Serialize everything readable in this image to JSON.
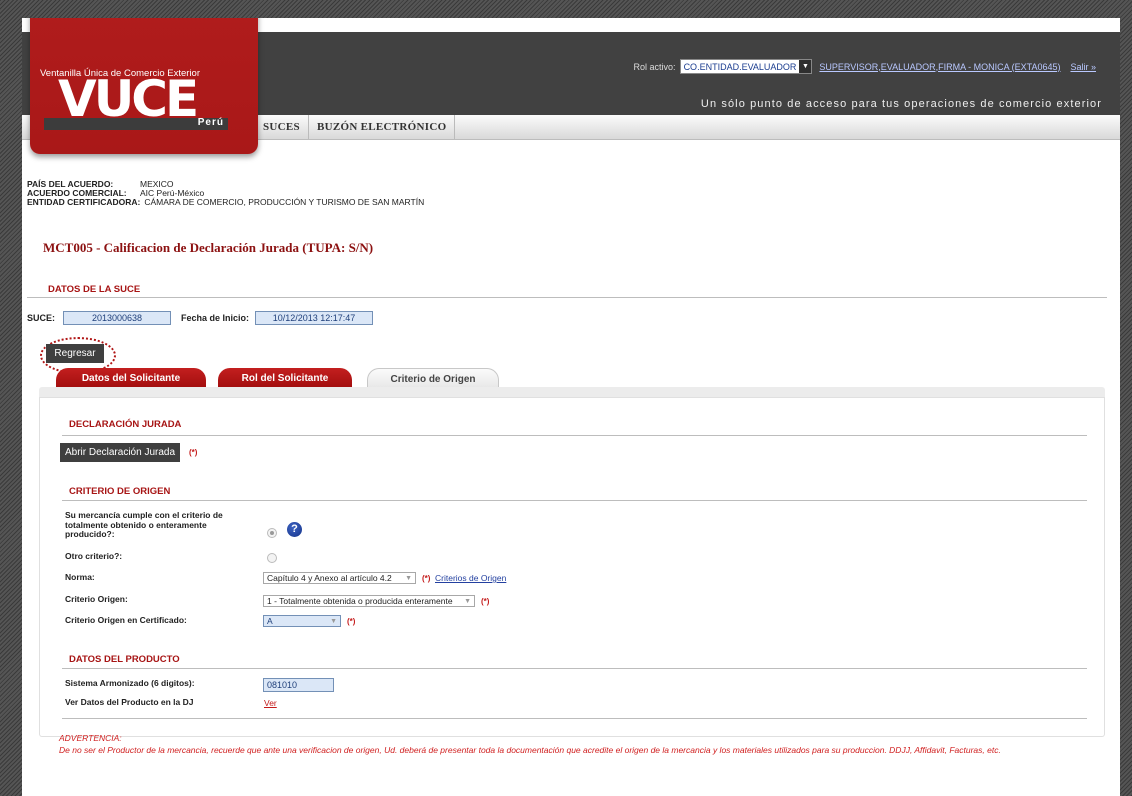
{
  "header": {
    "logo": {
      "subtitle": "Ventanilla Única de Comercio Exterior",
      "name": "VUCE",
      "country": "Perú"
    },
    "rol_label": "Rol activo:",
    "rol_value": "CO.ENTIDAD.EVALUADOR",
    "user_link": "SUPERVISOR,EVALUADOR,FIRMA - MONICA (EXTA0645)",
    "logout": "Salir »",
    "tagline": "Un sólo punto de acceso para tus operaciones de comercio exterior",
    "nav": [
      "SUCES",
      "BUZÓN ELECTRÓNICO"
    ]
  },
  "info": {
    "pais_label": "PAÍS DEL ACUERDO:",
    "pais_value": "MEXICO",
    "acuerdo_label": "ACUERDO COMERCIAL:",
    "acuerdo_value": "AIC Perú-México",
    "entidad_label": "ENTIDAD CERTIFICADORA:",
    "entidad_value": "CÁMARA DE COMERCIO, PRODUCCIÓN Y TURISMO DE SAN MARTÍN"
  },
  "page_title": "MCT005 - Calificacion de Declaración Jurada (TUPA: S/N)",
  "datos_suce": {
    "title": "DATOS DE LA SUCE",
    "suce_label": "SUCE:",
    "suce_value": "2013000638",
    "fecha_label": "Fecha de Inicio:",
    "fecha_value": "10/12/2013 12:17:47"
  },
  "regresar": "Regresar",
  "tabs": [
    "Datos del Solicitante",
    "Rol del Solicitante",
    "Criterio de Origen"
  ],
  "declaracion": {
    "title": "DECLARACIÓN JURADA",
    "button": "Abrir Declaración Jurada",
    "required": "(*)"
  },
  "criterio": {
    "title": "CRITERIO DE ORIGEN",
    "q_totalmente": "Su mercancía cumple con el criterio de totalmente obtenido o enteramente producido?:",
    "q_otro": "Otro criterio?:",
    "norma_label": "Norma:",
    "norma_value": "Capítulo 4 y Anexo al artículo 4.2",
    "norma_link": "Criterios de Origen",
    "criterio_label": "Criterio Origen:",
    "criterio_value": "1 - Totalmente obtenida o producida enteramente",
    "cert_label": "Criterio Origen en Certificado:",
    "cert_value": "A",
    "required": "(*)"
  },
  "producto": {
    "title": "DATOS DEL PRODUCTO",
    "sa_label": "Sistema Armonizado (6 digitos):",
    "sa_value": "081010",
    "ver_label": "Ver Datos del Producto en la DJ",
    "ver_link": "Ver"
  },
  "warning": {
    "title": "ADVERTENCIA:",
    "text": "De no ser el Productor de la mercancia, recuerde que ante una verificacion de origen, Ud. deberá de presentar toda la documentación que acredite el origen de la mercancia y los materiales utilizados para su produccion. DDJJ, Affidavit, Facturas, etc."
  },
  "colors": {
    "brand_red": "#a91818",
    "header_dark": "#414141",
    "field_blue": "#dbe7f7"
  }
}
